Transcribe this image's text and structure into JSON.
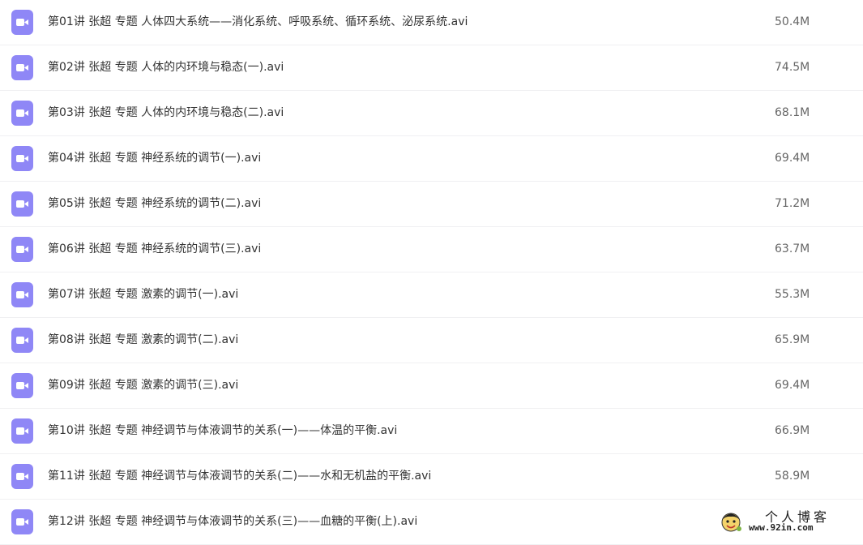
{
  "colors": {
    "icon_bg": "#8f87f6",
    "icon_fg": "#ffffff",
    "name_text": "#333333",
    "size_text": "#666666",
    "row_divider": "#f0f0f2"
  },
  "files": [
    {
      "name": "第01讲 张超 专题 人体四大系统——消化系统、呼吸系统、循环系统、泌尿系统.avi",
      "size": "50.4M",
      "icon": "video-file-icon"
    },
    {
      "name": "第02讲 张超 专题 人体的内环境与稳态(一).avi",
      "size": "74.5M",
      "icon": "video-file-icon"
    },
    {
      "name": "第03讲 张超 专题 人体的内环境与稳态(二).avi",
      "size": "68.1M",
      "icon": "video-file-icon"
    },
    {
      "name": "第04讲 张超 专题 神经系统的调节(一).avi",
      "size": "69.4M",
      "icon": "video-file-icon"
    },
    {
      "name": "第05讲 张超 专题 神经系统的调节(二).avi",
      "size": "71.2M",
      "icon": "video-file-icon"
    },
    {
      "name": "第06讲 张超 专题 神经系统的调节(三).avi",
      "size": "63.7M",
      "icon": "video-file-icon"
    },
    {
      "name": "第07讲 张超 专题 激素的调节(一).avi",
      "size": "55.3M",
      "icon": "video-file-icon"
    },
    {
      "name": "第08讲 张超 专题 激素的调节(二).avi",
      "size": "65.9M",
      "icon": "video-file-icon"
    },
    {
      "name": "第09讲 张超 专题 激素的调节(三).avi",
      "size": "69.4M",
      "icon": "video-file-icon"
    },
    {
      "name": "第10讲 张超 专题 神经调节与体液调节的关系(一)——体温的平衡.avi",
      "size": "66.9M",
      "icon": "video-file-icon"
    },
    {
      "name": "第11讲 张超 专题 神经调节与体液调节的关系(二)——水和无机盐的平衡.avi",
      "size": "58.9M",
      "icon": "video-file-icon"
    },
    {
      "name": "第12讲 张超 专题 神经调节与体液调节的关系(三)——血糖的平衡(上).avi",
      "size": "",
      "icon": "video-file-icon"
    }
  ],
  "watermark": {
    "title": "个人博客",
    "url": "www.92in.com"
  }
}
